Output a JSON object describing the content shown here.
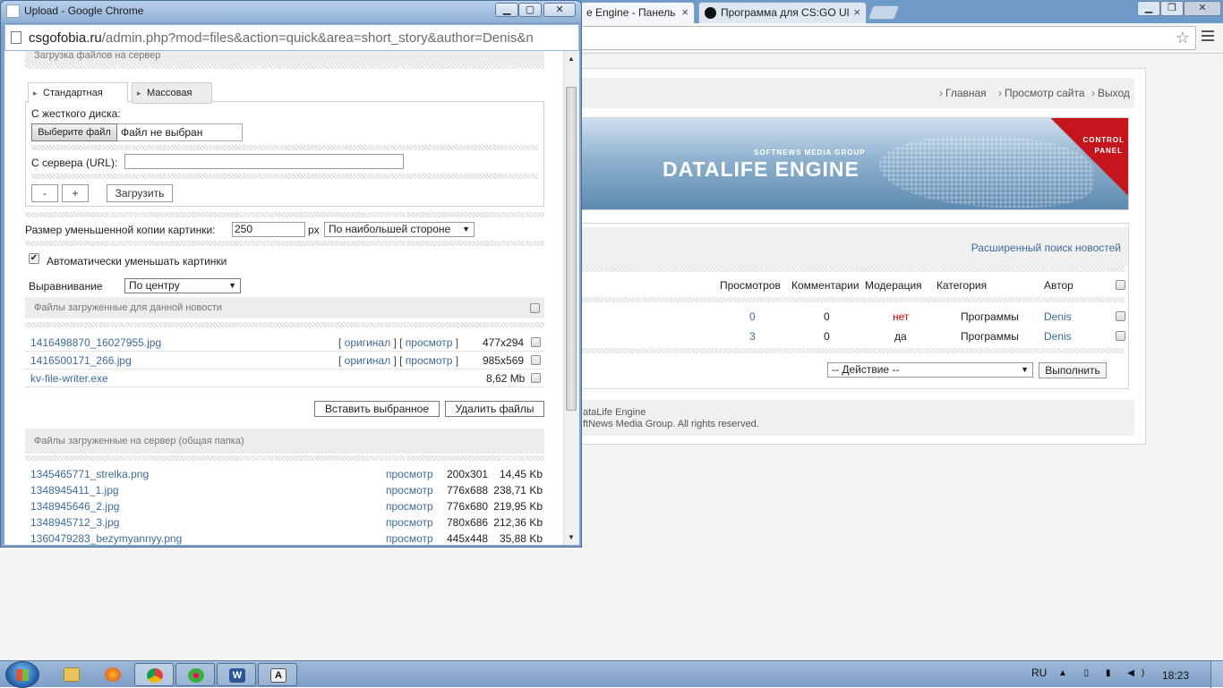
{
  "bg_window": {
    "tab1_title": "e Engine - Панель",
    "tab2_title": "Программа для CS:GO Ul",
    "tab_close": "×"
  },
  "dle": {
    "nav_home": "Главная",
    "nav_site": "Просмотр сайта",
    "nav_exit": "Выход",
    "banner_sub": "SOFTNEWS MEDIA GROUP",
    "banner_title": "DATALIFE ENGINE",
    "banner_cp1": "CONTROL",
    "banner_cp2": "PANEL",
    "adv_search": "Расширенный поиск новостей",
    "columns": {
      "views": "Просмотров",
      "comments": "Комментарии",
      "moderation": "Модерация",
      "category": "Категория",
      "author": "Автор"
    },
    "rows": [
      {
        "views": "0",
        "comments": "0",
        "moderation": "нет",
        "category": "Программы",
        "author": "Denis"
      },
      {
        "views": "3",
        "comments": "0",
        "moderation": "да",
        "category": "Программы",
        "author": "Denis"
      }
    ],
    "action_select": "-- Действие --",
    "execute_button": "Выполнить",
    "footer_line1": "ataLife Engine",
    "footer_line2": "ftNews Media Group. All rights reserved.",
    "colors": {
      "link": "#3e6a9a",
      "moderation_no": "#cc0000"
    }
  },
  "popup": {
    "title": "Upload - Google Chrome",
    "url_host": "csgofobia.ru",
    "url_path": "/admin.php?mod=files&action=quick&area=short_story&author=Denis&n",
    "section_upload": "Загрузка файлов на сервер",
    "tab_standard": "Стандартная",
    "tab_mass": "Массовая",
    "label_hdd": "С жесткого диска:",
    "file_button": "Выберите файл",
    "file_none": "Файл не выбран",
    "label_url": "С сервера (URL):",
    "btn_minus": "-",
    "btn_plus": "+",
    "btn_upload": "Загрузить",
    "label_thumb": "Размер уменьшенной копии картинки:",
    "thumb_value": "250",
    "thumb_unit": "px",
    "thumb_side": "По наибольшей стороне",
    "auto_resize_label": "Автоматически уменьшать картинки",
    "auto_resize_checked": true,
    "align_label": "Выравнивание",
    "align_value": "По центру",
    "section_news_files": "Файлы загруженные для данной новости",
    "news_files": [
      {
        "name": "1416498870_16027955.jpg",
        "original": "оригинал",
        "view": "просмотр",
        "dims": "477x294"
      },
      {
        "name": "1416500171_266.jpg",
        "original": "оригинал",
        "view": "просмотр",
        "dims": "985x569"
      },
      {
        "name": "kv-file-writer.exe",
        "size": "8,62 Mb"
      }
    ],
    "btn_insert": "Вставить выбранное",
    "btn_delete": "Удалить файлы",
    "section_server_files": "Файлы загруженные на сервер (общая папка)",
    "server_files": [
      {
        "name": "1345465771_strelka.png",
        "view": "просмотр",
        "dims": "200x301",
        "size": "14,45 Kb"
      },
      {
        "name": "1348945411_1.jpg",
        "view": "просмотр",
        "dims": "776x688",
        "size": "238,71 Kb"
      },
      {
        "name": "1348945646_2.jpg",
        "view": "просмотр",
        "dims": "776x680",
        "size": "219,95 Kb"
      },
      {
        "name": "1348945712_3.jpg",
        "view": "просмотр",
        "dims": "780x686",
        "size": "212,36 Kb"
      },
      {
        "name": "1360479283_bezymyannyy.png",
        "view": "просмотр",
        "dims": "445x448",
        "size": "35,88 Kb"
      }
    ]
  },
  "taskbar": {
    "lang": "RU",
    "clock": "18:23",
    "word_glyph": "W",
    "font_glyph": "A"
  }
}
